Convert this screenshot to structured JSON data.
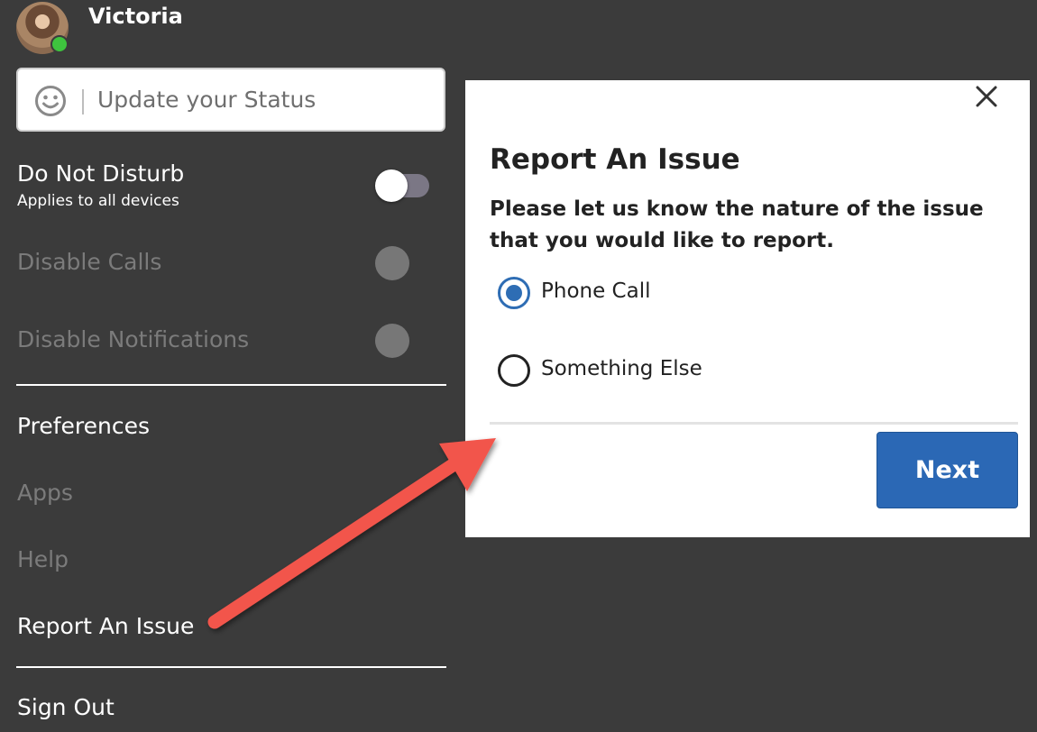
{
  "profile": {
    "name": "Victoria",
    "status_color": "#3ec43e"
  },
  "status_input": {
    "icon": "smiley-icon",
    "placeholder": "Update your Status"
  },
  "settings": {
    "do_not_disturb": {
      "label": "Do Not Disturb",
      "sublabel": "Applies to all devices",
      "enabled": false
    },
    "disable_calls": {
      "label": "Disable Calls",
      "enabled": false,
      "disabled": true
    },
    "disable_notifications": {
      "label": "Disable Notifications",
      "enabled": false,
      "disabled": true
    }
  },
  "menu": {
    "preferences": "Preferences",
    "apps": "Apps",
    "help": "Help",
    "report_issue": "Report An Issue",
    "sign_out": "Sign Out"
  },
  "dialog": {
    "title": "Report An Issue",
    "prompt": "Please let us know the nature of the issue that you would like to report.",
    "options": [
      {
        "label": "Phone Call",
        "selected": true
      },
      {
        "label": "Something Else",
        "selected": false
      }
    ],
    "next_label": "Next",
    "close_icon": "close-icon",
    "accent_color": "#2b68b5"
  },
  "annotation": {
    "arrow_color": "#f2554c"
  }
}
